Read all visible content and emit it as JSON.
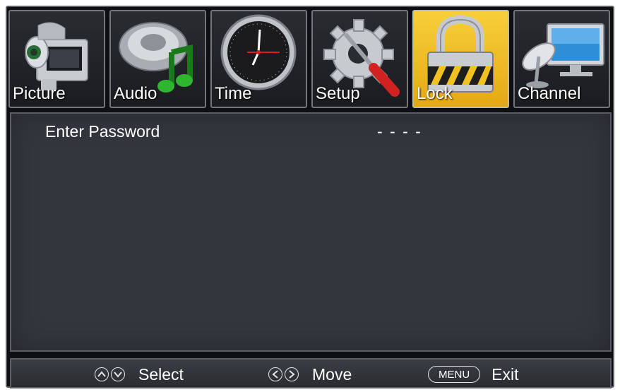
{
  "tabs": [
    {
      "label": "Picture",
      "icon": "video-camera-icon",
      "active": false
    },
    {
      "label": "Audio",
      "icon": "speaker-music-note-icon",
      "active": false
    },
    {
      "label": "Time",
      "icon": "clock-icon",
      "active": false
    },
    {
      "label": "Setup",
      "icon": "gear-screwdriver-icon",
      "active": false
    },
    {
      "label": "Lock",
      "icon": "padlock-icon",
      "active": true
    },
    {
      "label": "Channel",
      "icon": "satellite-monitor-icon",
      "active": false
    }
  ],
  "content": {
    "password_label": "Enter Password",
    "password_value": "- - - -"
  },
  "footer": {
    "select_label": "Select",
    "move_label": "Move",
    "menu_key": "MENU",
    "exit_label": "Exit"
  },
  "colors": {
    "active_tab": "#f2c12e",
    "panel_bg": "#33363d",
    "text": "#ffffff"
  }
}
